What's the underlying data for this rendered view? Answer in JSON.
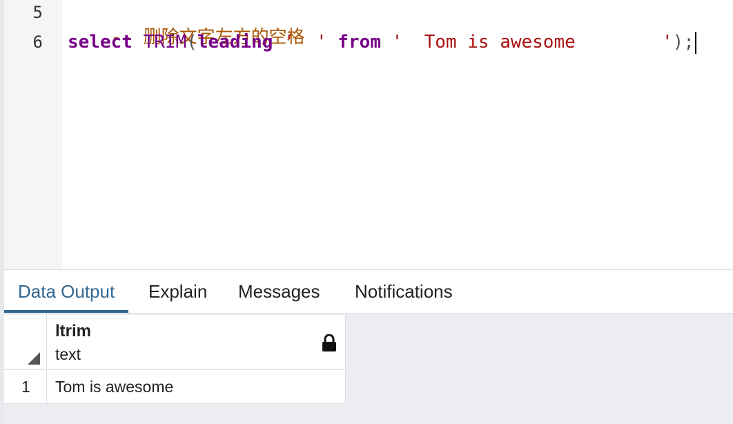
{
  "editor": {
    "lines": [
      {
        "number": "5",
        "comment": "-- 删除文字左方的空格"
      },
      {
        "number": "6",
        "keyword_select": "select",
        "function_name": "TRIM",
        "paren_open": "(",
        "keyword_leading": "leading",
        "string_1": "'  '",
        "keyword_from": "from",
        "string_2": "'  Tom is awesome        '",
        "paren_close": ")",
        "semicolon": ";"
      }
    ]
  },
  "tabs": [
    {
      "label": "Data Output",
      "active": true
    },
    {
      "label": "Explain",
      "active": false
    },
    {
      "label": "Messages",
      "active": false
    },
    {
      "label": "Notifications",
      "active": false
    }
  ],
  "results": {
    "columns": [
      {
        "name": "ltrim",
        "type": "text",
        "icon": "lock-icon"
      }
    ],
    "rows": [
      {
        "row_number": "1",
        "values": [
          "Tom is awesome"
        ]
      }
    ]
  },
  "colors": {
    "keyword": "#770088",
    "string": "#aa1111",
    "comment": "#aa5500",
    "active_tab": "#326690"
  }
}
